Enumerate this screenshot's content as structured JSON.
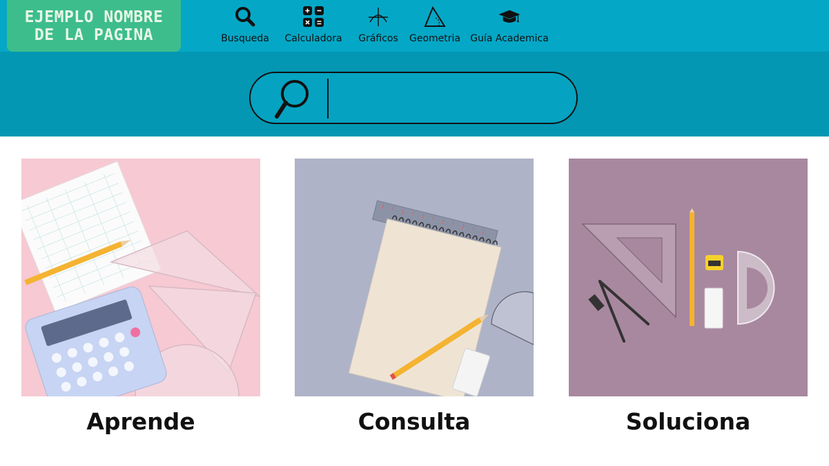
{
  "site": {
    "name": "EJEMPLO NOMBRE\nDE LA PAGINA"
  },
  "nav": {
    "items": [
      {
        "label": "Busqueda",
        "icon": "search-icon"
      },
      {
        "label": "Calculadora",
        "icon": "calculator-icon"
      },
      {
        "label": "Gráficos",
        "icon": "graph-icon"
      },
      {
        "label": "Geometria",
        "icon": "geometry-icon"
      },
      {
        "label": "Guía Academica",
        "icon": "graduation-cap-icon"
      }
    ]
  },
  "search": {
    "value": "",
    "placeholder": ""
  },
  "cards": [
    {
      "title": "Aprende",
      "image": "pink-math-tools-photo"
    },
    {
      "title": "Consulta",
      "image": "blue-notebook-photo"
    },
    {
      "title": "Soluciona",
      "image": "purple-geometry-tools-photo"
    }
  ],
  "colors": {
    "header": "#05a7c6",
    "search_band": "#0397b3",
    "logo_bg": "#3dbd8c",
    "card1_bg": "#f6c9d3",
    "card2_bg": "#aeb3c8",
    "card3_bg": "#a8889f"
  }
}
